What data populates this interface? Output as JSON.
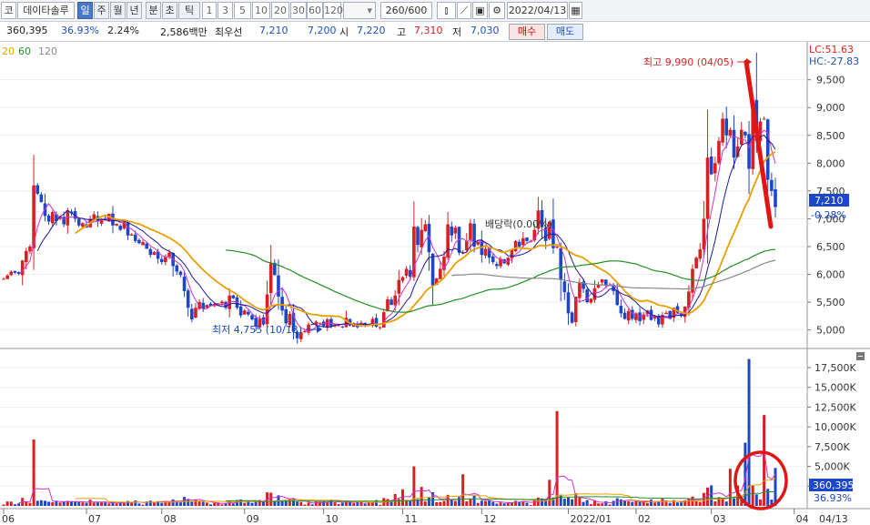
{
  "toolbar": {
    "market": "코",
    "stock": "데이타솔루",
    "periods": [
      "일",
      "주",
      "월",
      "년",
      "분",
      "초",
      "틱"
    ],
    "intervals": [
      "1",
      "3",
      "5",
      "10",
      "20",
      "30",
      "60",
      "120"
    ],
    "count": "260/600",
    "date": "2022/04/13"
  },
  "info": {
    "price": "360,395",
    "rate": "36.93%",
    "rate2": "2.24%",
    "vol": "2,586백만",
    "l1": "최우선",
    "v1": "7,210",
    "v2": "7,200",
    "l2": "시",
    "v3": "7,220",
    "l3": "고",
    "v4": "7,310",
    "l4": "저",
    "v5": "7,030",
    "buy": "매수",
    "sell": "매도"
  },
  "legend": {
    "m20": "20",
    "m60": "60",
    "m120": "120"
  },
  "price_axis": {
    "ticks": [
      "9,500",
      "9,000",
      "8,500",
      "8,000",
      "7,500",
      "7,000",
      "6,500",
      "6,000",
      "5,500",
      "5,000"
    ],
    "lc": "LC:51.63",
    "hc": "HC:-27.83",
    "cur": "7,210",
    "curpct": "-0.28%"
  },
  "vol_axis": {
    "ticks": [
      "17,500K",
      "15,000K",
      "12,500K",
      "10,000K",
      "7,500K",
      "5,000K",
      "2,500K"
    ],
    "cur": "360,395",
    "curpct": "36.93%"
  },
  "x_axis": {
    "labels": [
      "06",
      "07",
      "08",
      "09",
      "10",
      "11",
      "12",
      "2022/01",
      "02",
      "03",
      "04",
      "04/13"
    ]
  },
  "annotations": {
    "high": "최고 9,990 (04/05)",
    "low": "최저 4,755 (10/13)",
    "dividend": "배당락(0.00%)"
  },
  "chart_data": {
    "type": "candlestick",
    "price_range": [
      4700,
      10100
    ],
    "volume_range_k": [
      0,
      19000
    ],
    "high": {
      "value": 9990,
      "date": "04/05"
    },
    "low": {
      "value": 4755,
      "date": "10/13"
    },
    "current": 7210,
    "close": [
      5920,
      5980,
      6050,
      6030,
      6010,
      6250,
      6420,
      6500,
      7600,
      7450,
      7300,
      7050,
      6950,
      7120,
      6960,
      7040,
      6900,
      7150,
      7100,
      7000,
      6880,
      6920,
      6840,
      7000,
      7080,
      6950,
      7000,
      6980,
      7090,
      6880,
      6910,
      6800,
      6950,
      6700,
      6720,
      6600,
      6560,
      6580,
      6460,
      6350,
      6400,
      6280,
      6220,
      6310,
      6390,
      6150,
      6050,
      5990,
      5700,
      5400,
      5190,
      5400,
      5500,
      5380,
      5450,
      5430,
      5470,
      5480,
      5510,
      5400,
      5620,
      5570,
      5400,
      5260,
      5350,
      5280,
      5190,
      5060,
      5200,
      5100,
      5640,
      6200,
      5990,
      5600,
      5350,
      5120,
      5290,
      4970,
      4850,
      4960,
      4980,
      5100,
      5100,
      5150,
      5130,
      5070,
      5190,
      5060,
      5100,
      5090,
      5050,
      5220,
      5080,
      5120,
      5050,
      5130,
      5080,
      5100,
      5200,
      5060,
      5050,
      5320,
      5550,
      5450,
      5620,
      5900,
      5950,
      6100,
      5960,
      6860,
      6530,
      6800,
      6900,
      6400,
      5800,
      5930,
      6100,
      6320,
      6900,
      6700,
      6840,
      6390,
      6400,
      6600,
      6920,
      6500,
      6580,
      6350,
      6460,
      6300,
      6220,
      6150,
      6280,
      6200,
      6300,
      6450,
      6600,
      6500,
      6650,
      6600,
      6600,
      6800,
      7150,
      6850,
      6600,
      6950,
      6470,
      6500,
      5900,
      5680,
      5300,
      5130,
      5600,
      5860,
      5740,
      5500,
      5560,
      5750,
      5820,
      5910,
      5800,
      5810,
      5700,
      5450,
      5300,
      5200,
      5340,
      5200,
      5300,
      5160,
      5280,
      5350,
      5180,
      5250,
      5100,
      5270,
      5310,
      5200,
      5400,
      5310,
      5250,
      5420,
      5690,
      6100,
      6300,
      6450,
      7000,
      8100,
      7800,
      8000,
      8400,
      8800,
      8500,
      8600,
      8100,
      8300,
      8600,
      8500,
      7900,
      9100,
      8400,
      8750,
      8800,
      7700,
      7500,
      7210
    ]
  },
  "colors": {
    "up": "#d92020",
    "down": "#1c47c8",
    "ma5": "#cc33cc",
    "ma10": "#1a1aa0",
    "ma20": "#e8a000",
    "ma60": "#239023",
    "ma120": "#888888"
  }
}
